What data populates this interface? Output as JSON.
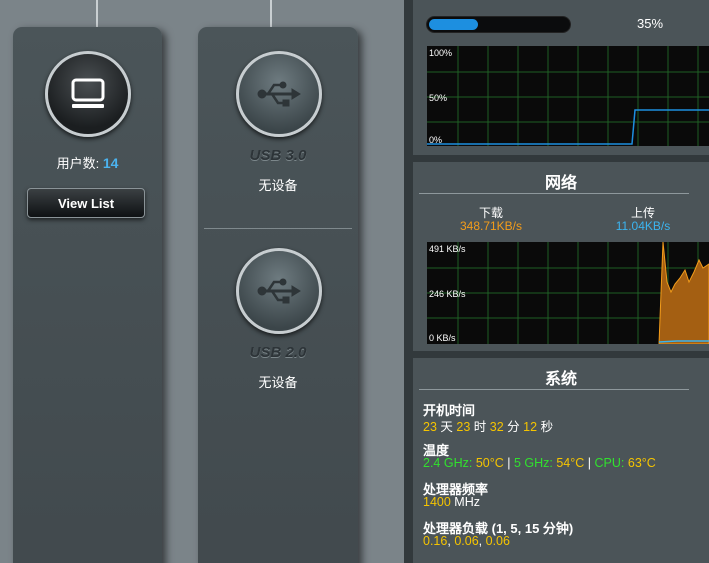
{
  "clients": {
    "icon": "monitor-icon",
    "users_label": "用户数:",
    "users_count": "14",
    "view_list_label": "View List"
  },
  "usb": {
    "icon": "usb-icon",
    "ports": [
      {
        "title": "USB 3.0",
        "status": "无设备"
      },
      {
        "title": "USB 2.0",
        "status": "无设备"
      }
    ]
  },
  "cpu": {
    "usage_percent": 35,
    "usage_label": "35%",
    "graph_labels": [
      "100%",
      "50%",
      "0%"
    ],
    "line_color": "#1d8fe0"
  },
  "network": {
    "title": "网络",
    "download_label": "下载",
    "download_value": "348.71KB/s",
    "upload_label": "上传",
    "upload_value": "11.04KB/s",
    "graph_labels": [
      "491 KB/s",
      "246 KB/s",
      "0 KB/s"
    ],
    "download_color": "#f39c1a",
    "upload_color": "#3bb4ef"
  },
  "system": {
    "title": "系统",
    "uptime_label": "开机时间",
    "uptime": {
      "days": "23",
      "days_unit": "天",
      "hours": "23",
      "hours_unit": "时",
      "minutes": "32",
      "minutes_unit": "分",
      "seconds": "12",
      "seconds_unit": "秒"
    },
    "temperature_label": "温度",
    "temperature": {
      "g24_label": "2.4 GHz:",
      "g24_value": "50°C",
      "g5_label": "5 GHz:",
      "g5_value": "54°C",
      "cpu_label": "CPU:",
      "cpu_value": "63°C",
      "separator": "|"
    },
    "freq_label": "处理器频率",
    "freq_value": "1400",
    "freq_unit": "MHz",
    "load_label": "处理器负载 (1, 5, 15 分钟)",
    "load": {
      "l1": "0.16",
      "l5": "0.06",
      "l15": "0.06",
      "sep": ","
    }
  }
}
